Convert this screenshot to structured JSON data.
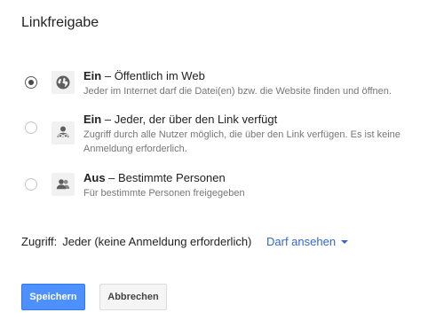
{
  "dialog": {
    "title": "Linkfreigabe"
  },
  "options": [
    {
      "state": "Ein",
      "title_rest": " – Öffentlich im Web",
      "description": "Jeder im Internet darf die Datei(en) bzw. die Website finden und öffnen.",
      "icon": "globe-icon",
      "selected": true
    },
    {
      "state": "Ein",
      "title_rest": " – Jeder, der über den Link verfügt",
      "description": "Zugriff durch alle Nutzer möglich, die über den Link verfügen. Es ist keine Anmeldung erforderlich.",
      "icon": "link-person-icon",
      "selected": false
    },
    {
      "state": "Aus",
      "title_rest": " – Bestimmte Personen",
      "description": "Für bestimmte Personen freigegeben",
      "icon": "people-icon",
      "selected": false
    }
  ],
  "access": {
    "label": "Zugriff:",
    "value": "Jeder (keine Anmeldung erforderlich)",
    "dropdown_label": "Darf ansehen"
  },
  "buttons": {
    "save_label": "Speichern",
    "cancel_label": "Abbrechen"
  },
  "colors": {
    "primary_button": "#4d90fe",
    "link": "#3366cc",
    "description_text": "#777777"
  }
}
